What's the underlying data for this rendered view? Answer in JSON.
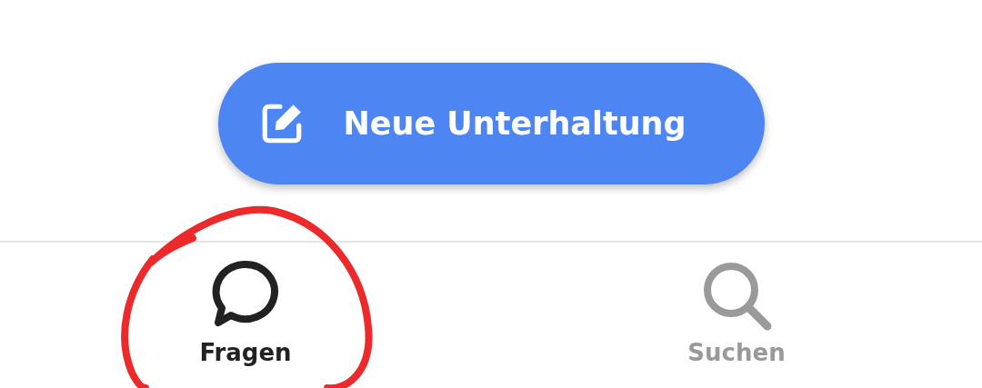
{
  "new_button": {
    "label": "Neue Unterhaltung"
  },
  "tabs": [
    {
      "label": "Fragen",
      "selected": true,
      "kind": "chat"
    },
    {
      "label": "Suchen",
      "selected": false,
      "kind": "search"
    }
  ]
}
